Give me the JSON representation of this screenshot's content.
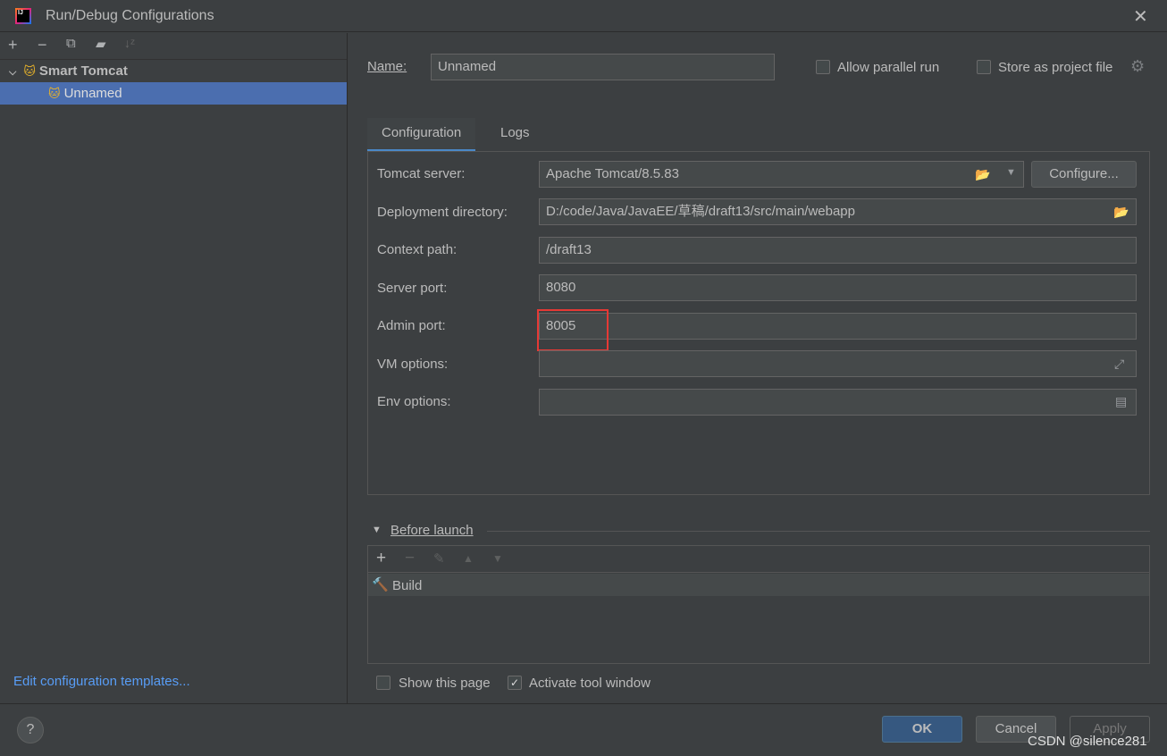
{
  "window": {
    "title": "Run/Debug Configurations"
  },
  "tree": {
    "group": "Smart Tomcat",
    "items": [
      {
        "label": "Unnamed",
        "selected": true
      }
    ]
  },
  "left_link": "Edit configuration templates...",
  "name": {
    "label": "Name:",
    "value": "Unnamed"
  },
  "allow_parallel": {
    "label": "Allow parallel run",
    "checked": false
  },
  "store_project": {
    "label": "Store as project file",
    "checked": false
  },
  "tabs": [
    {
      "label": "Configuration",
      "active": true
    },
    {
      "label": "Logs",
      "active": false
    }
  ],
  "fields": [
    {
      "label": "Tomcat server:",
      "value": "Apache Tomcat/8.5.83"
    },
    {
      "label": "Deployment directory:",
      "value": "D:/code/Java/JavaEE/草稿/draft13/src/main/webapp"
    },
    {
      "label": "Context path:",
      "value": "/draft13"
    },
    {
      "label": "Server port:",
      "value": "8080"
    },
    {
      "label": "Admin port:",
      "value": "8005"
    },
    {
      "label": "VM options:",
      "value": ""
    },
    {
      "label": "Env options:",
      "value": ""
    }
  ],
  "configure_button": "Configure...",
  "before_launch": {
    "title": "Before launch",
    "items": [
      "Build"
    ]
  },
  "show_page": {
    "label": "Show this page",
    "checked": false
  },
  "activate_tool": {
    "label": "Activate tool window",
    "checked": true
  },
  "buttons": {
    "ok": "OK",
    "cancel": "Cancel",
    "apply": "Apply",
    "help": "?"
  },
  "watermark": "CSDN @silence281",
  "colors": {
    "accent": "#4b6eaf",
    "highlight_box": "#e53935",
    "ok": "#365880"
  }
}
